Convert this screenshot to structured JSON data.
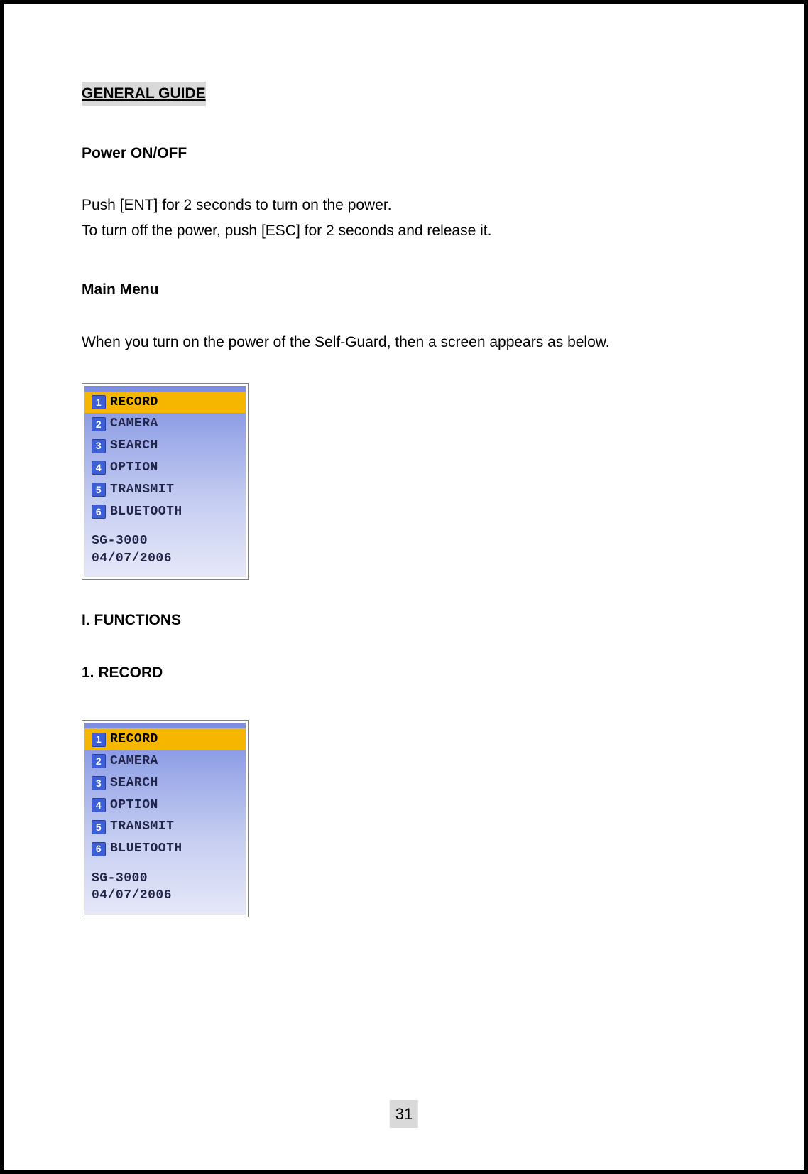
{
  "title": "GENERAL GUIDE",
  "power_heading": "Power ON/OFF",
  "power_line1": "Push [ENT] for 2 seconds to turn on the power.",
  "power_line2": "To turn off the power, push [ESC] for 2 seconds and release it.",
  "mainmenu_heading": "Main Menu",
  "mainmenu_intro": "When you turn on the power of the Self-Guard, then a screen appears as below.",
  "device1": {
    "items": [
      {
        "num": "1",
        "label": "RECORD",
        "selected": true
      },
      {
        "num": "2",
        "label": "CAMERA",
        "selected": false
      },
      {
        "num": "3",
        "label": "SEARCH",
        "selected": false
      },
      {
        "num": "4",
        "label": "OPTION",
        "selected": false
      },
      {
        "num": "5",
        "label": "TRANSMIT",
        "selected": false
      },
      {
        "num": "6",
        "label": "BLUETOOTH",
        "selected": false
      }
    ],
    "model": "SG-3000",
    "date": "04/07/2006"
  },
  "functions_heading": "I. FUNCTIONS",
  "record_heading": "1. RECORD",
  "device2": {
    "items": [
      {
        "num": "1",
        "label": "RECORD",
        "selected": true
      },
      {
        "num": "2",
        "label": "CAMERA",
        "selected": false
      },
      {
        "num": "3",
        "label": "SEARCH",
        "selected": false
      },
      {
        "num": "4",
        "label": "OPTION",
        "selected": false
      },
      {
        "num": "5",
        "label": "TRANSMIT",
        "selected": false
      },
      {
        "num": "6",
        "label": "BLUETOOTH",
        "selected": false
      }
    ],
    "model": "SG-3000",
    "date": "04/07/2006"
  },
  "page_number": "31"
}
